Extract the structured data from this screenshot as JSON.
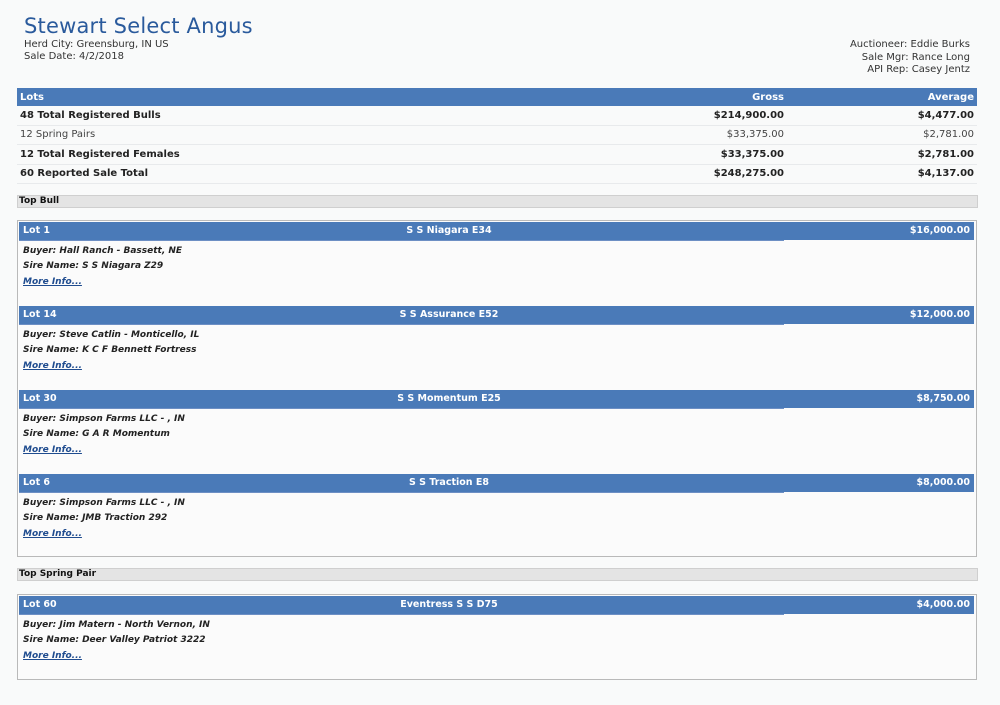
{
  "header": {
    "title": "Stewart Select Angus",
    "herd_city": "Herd City: Greensburg, IN US",
    "sale_date": "Sale Date: 4/2/2018",
    "auctioneer": "Auctioneer: Eddie Burks",
    "sale_mgr": "Sale Mgr: Rance Long",
    "api_rep": "API Rep: Casey Jentz"
  },
  "summary": {
    "headers": {
      "lots": "Lots",
      "gross": "Gross",
      "average": "Average"
    },
    "rows": [
      {
        "lots": "48 Total Registered Bulls",
        "gross": "$214,900.00",
        "average": "$4,477.00"
      },
      {
        "lots": "12 Spring Pairs",
        "gross": "$33,375.00",
        "average": "$2,781.00"
      },
      {
        "lots": "12 Total Registered Females",
        "gross": "$33,375.00",
        "average": "$2,781.00"
      },
      {
        "lots": "60 Reported Sale Total",
        "gross": "$248,275.00",
        "average": "$4,137.00"
      }
    ]
  },
  "top_bull": {
    "title": "Top Bull",
    "lots": [
      {
        "lot": "Lot 1",
        "name": "S S Niagara E34",
        "price": "$16,000.00",
        "buyer": "Buyer: Hall Ranch - Bassett, NE",
        "sire": "Sire Name: S S Niagara Z29",
        "more": "More Info..."
      },
      {
        "lot": "Lot 14",
        "name": "S S Assurance E52",
        "price": "$12,000.00",
        "buyer": "Buyer: Steve Catlin - Monticello, IL",
        "sire": "Sire Name: K C F Bennett Fortress",
        "more": "More Info..."
      },
      {
        "lot": "Lot 30",
        "name": "S S Momentum E25",
        "price": "$8,750.00",
        "buyer": "Buyer: Simpson Farms LLC - , IN",
        "sire": "Sire Name: G A R Momentum",
        "more": "More Info..."
      },
      {
        "lot": "Lot 6",
        "name": "S S Traction E8",
        "price": "$8,000.00",
        "buyer": "Buyer: Simpson Farms LLC - , IN",
        "sire": "Sire Name: JMB Traction 292",
        "more": "More Info..."
      }
    ]
  },
  "top_spring_pair": {
    "title": "Top Spring Pair",
    "lots": [
      {
        "lot": "Lot 60",
        "name": "Eventress S S D75",
        "price": "$4,000.00",
        "buyer": "Buyer: Jim Matern - North Vernon, IN",
        "sire": "Sire Name: Deer Valley Patriot 3222",
        "more": "More Info..."
      }
    ]
  },
  "colors": {
    "header_blue": "#4a7ab8",
    "title_blue": "#2a5a9c",
    "link_blue": "#1f4c8f"
  }
}
